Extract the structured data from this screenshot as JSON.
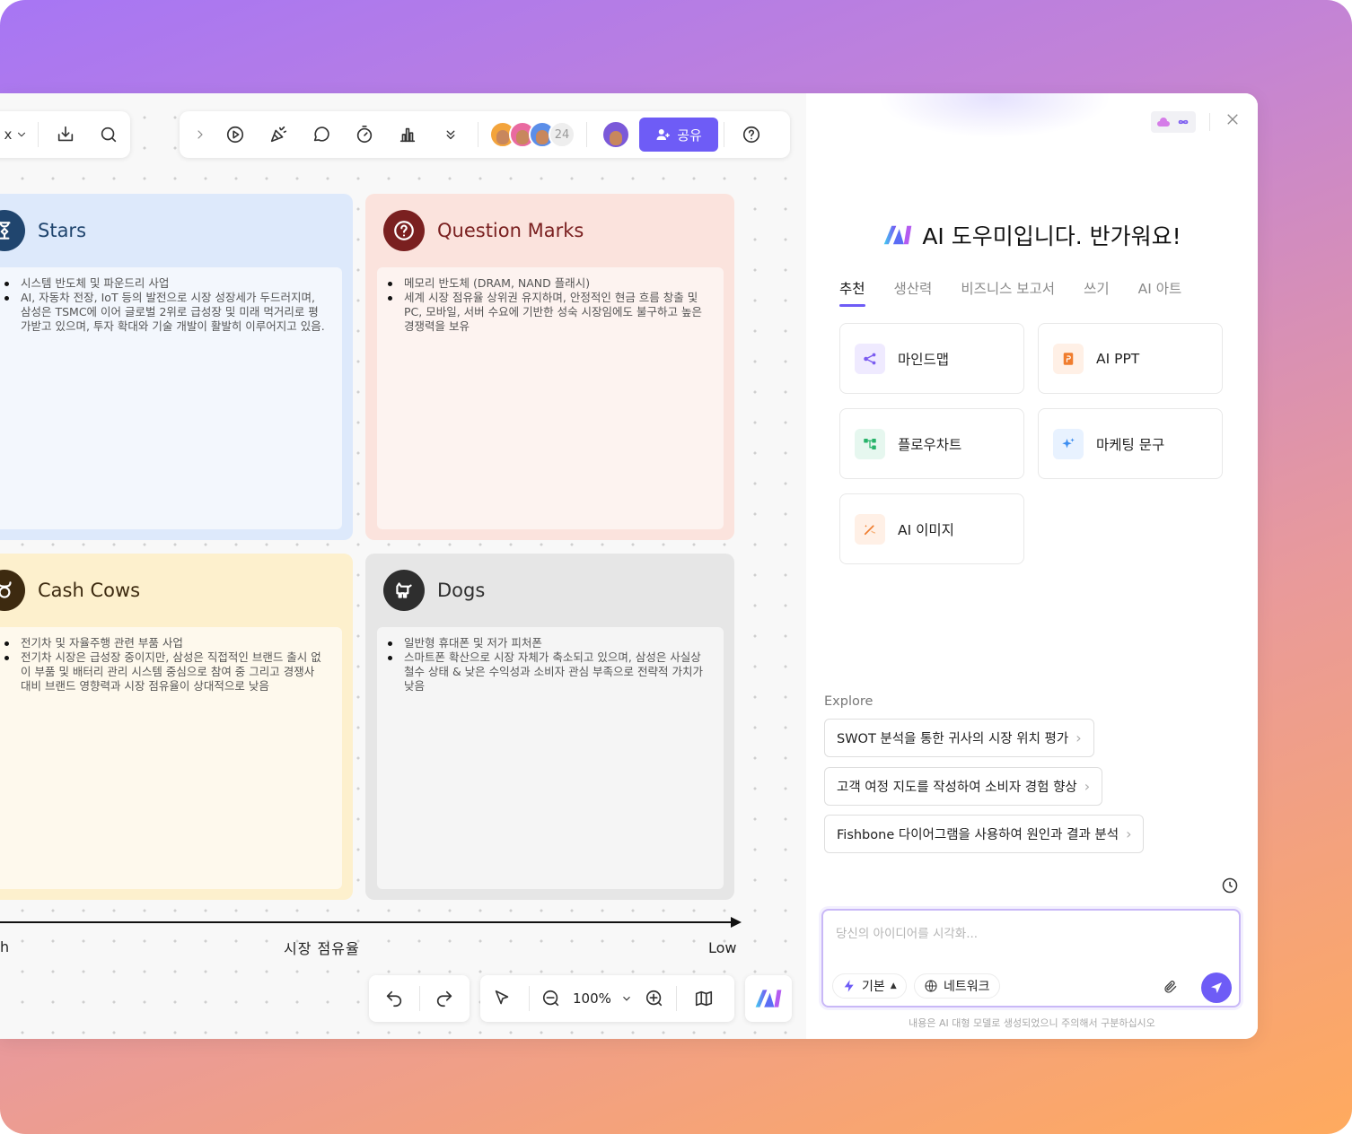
{
  "toolbar": {
    "left_partial_label": "x",
    "avatar_count": "24",
    "share_label": "공유",
    "avatar_colors": [
      "#f3a43c",
      "#e96aa0",
      "#5b8ee8"
    ],
    "user_avatar_color": "#7b59d9"
  },
  "quadrants": {
    "stars": {
      "title": "Stars",
      "color": "#20456e",
      "bullets": [
        "시스템 반도체 및 파운드리 사업",
        "AI, 자동차 전장, IoT 등의 발전으로 시장 성장세가 두드러지며, 삼성은 TSMC에 이어 글로벌 2위로 급성장 및 미래 먹거리로 평가받고 있으며, 투자 확대와 기술 개발이 활발히 이루어지고 있음."
      ]
    },
    "question_marks": {
      "title": "Question Marks",
      "color": "#7a2020",
      "bullets": [
        "메모리 반도체 (DRAM, NAND 플래시)",
        "세계 시장 점유율 상위권 유지하며, 안정적인 현금 흐름 창출 및 PC, 모바일, 서버 수요에 기반한 성숙 시장임에도 불구하고 높은 경쟁력을 보유"
      ]
    },
    "cash_cows": {
      "title": "Cash Cows",
      "color": "#3d2a10",
      "bullets": [
        "전기차 및 자율주행 관련 부품 사업",
        "전기차 시장은 급성장 중이지만, 삼성은 직접적인 브랜드 출시 없이 부품 및 배터리 관리 시스템 중심으로 참여 중 그리고 경쟁사 대비 브랜드 영향력과 시장 점유율이 상대적으로 낮음"
      ]
    },
    "dogs": {
      "title": "Dogs",
      "color": "#2e2e2e",
      "bullets": [
        "일반형 휴대폰 및 저가 피처폰",
        "스마트폰 확산으로 시장 자체가 축소되고 있으며, 삼성은 사실상 철수 상태 & 낮은 수익성과 소비자 관심 부족으로 전략적 가치가 낮음"
      ]
    }
  },
  "axis": {
    "left_label": "h",
    "center_label": "시장 점유율",
    "right_label": "Low"
  },
  "bottom_bar": {
    "zoom": "100%"
  },
  "panel": {
    "title": "AI 도우미입니다. 반가워요!",
    "tabs": [
      "추천",
      "생산력",
      "비즈니스 보고서",
      "쓰기",
      "AI 아트"
    ],
    "tiles": [
      {
        "label": "마인드맵",
        "icon": "mindmap-icon",
        "bg": "#efeaff",
        "fg": "#7b5cf0"
      },
      {
        "label": "AI PPT",
        "icon": "ppt-icon",
        "bg": "#fff0e6",
        "fg": "#f07d2e"
      },
      {
        "label": "플로우차트",
        "icon": "flowchart-icon",
        "bg": "#e6f7ef",
        "fg": "#27b36a"
      },
      {
        "label": "마케팅 문구",
        "icon": "sparkle-icon",
        "bg": "#e8f2ff",
        "fg": "#3d8ef0"
      },
      {
        "label": "AI 이미지",
        "icon": "image-wand-icon",
        "bg": "#fff0e6",
        "fg": "#f07d2e"
      }
    ],
    "explore_label": "Explore",
    "explore_items": [
      "SWOT 분석을 통한 귀사의 시장 위치 평가",
      "고객 여정 지도를 작성하여 소비자 경험 향상",
      "Fishbone 다이어그램을 사용하여 원인과 결과 분석"
    ],
    "input_placeholder": "당신의 아이디어를 시각화...",
    "mode_label": "기본",
    "network_label": "네트워크",
    "disclaimer": "내용은 AI 대형 모델로 생성되었으니 주의해서 구분하십시오",
    "accent_color": "#6e5cf6"
  }
}
